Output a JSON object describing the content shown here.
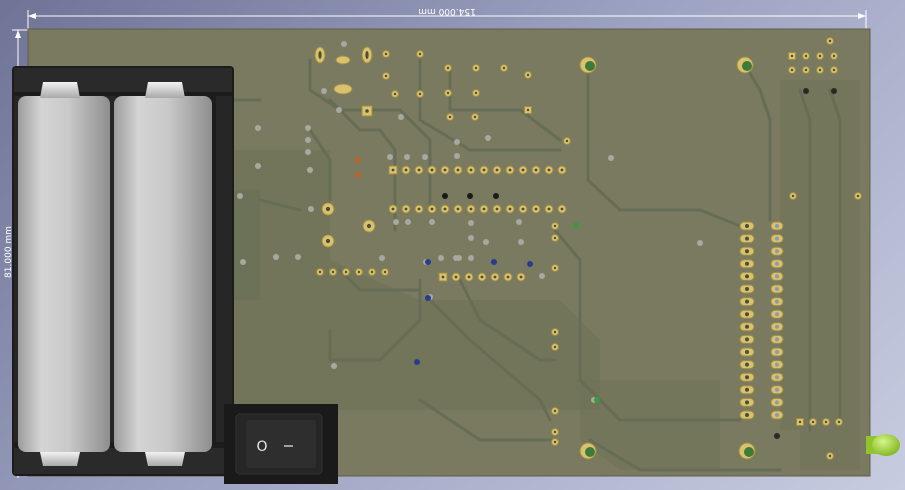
{
  "dimensions": {
    "width_label": "154.000 mm",
    "height_label": "81.000 mm"
  },
  "switch": {
    "off_symbol": "O",
    "on_symbol": "I"
  },
  "colors": {
    "board": "#7a7a60",
    "copper": "#6d7359",
    "pad_gold": "#d8c270",
    "battery": "#c9c9c9",
    "battery_holder": "#1e1e1e",
    "led_green": "#9fd43a",
    "dimension_line": "#ffffff"
  },
  "icons": [
    "battery-cell-icon",
    "rocker-switch-icon",
    "led-icon"
  ]
}
